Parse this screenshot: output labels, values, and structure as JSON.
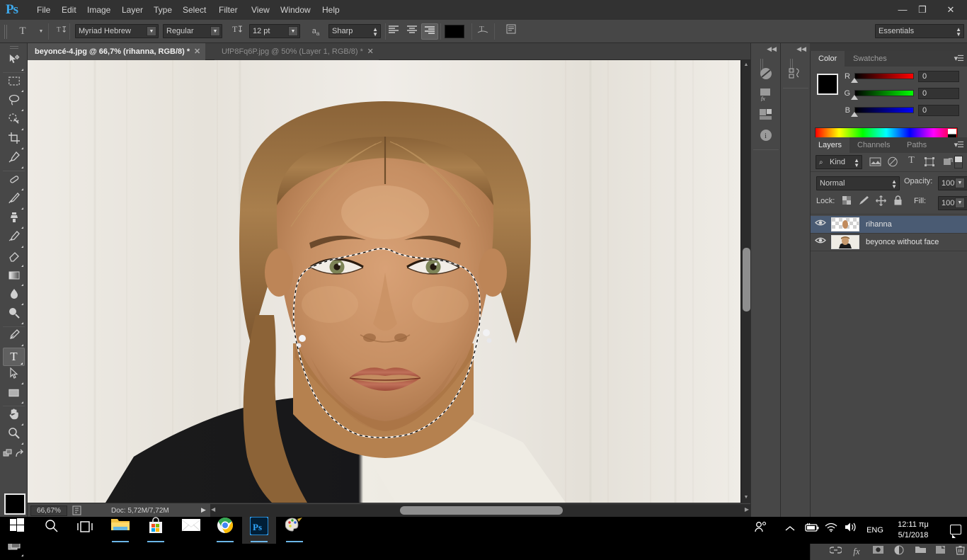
{
  "app": {
    "name": "Adobe Photoshop",
    "logo_text": "Ps",
    "workspace": "Essentials"
  },
  "titlebar": {
    "menus": [
      "File",
      "Edit",
      "Image",
      "Layer",
      "Type",
      "Select",
      "Filter",
      "View",
      "Window",
      "Help"
    ],
    "minimize": "—",
    "maximize": "❐",
    "close": "✕"
  },
  "options_bar": {
    "tool_icon": "T",
    "tool_preset_arrow": "▼",
    "orientation_icon": "text-orientation",
    "font_family": "Myriad Hebrew",
    "font_style": "Regular",
    "size_icon": "font-size",
    "font_size": "12 pt",
    "antialias_icon": "aa",
    "antialias": "Sharp",
    "align": [
      "align-left",
      "align-center",
      "align-right"
    ],
    "align_active": "align-right",
    "text_color": "#000000",
    "warp_icon": "warp-text",
    "panels_icon": "character-paragraph-panels"
  },
  "tabs": [
    {
      "label": "beyoncé-4.jpg @ 66,7% (rihanna, RGB/8) *",
      "active": true,
      "close": "✕"
    },
    {
      "label": "UfP8Fq6P.jpg @ 50% (Layer 1, RGB/8) *",
      "active": false,
      "close": "✕"
    }
  ],
  "toolbar": {
    "tools": [
      {
        "name": "move-tool",
        "glyph": "✥",
        "active": false
      },
      {
        "name": "rectangular-marquee-tool",
        "glyph": "▭",
        "active": false
      },
      {
        "name": "lasso-tool",
        "glyph": "◯",
        "active": false
      },
      {
        "name": "quick-selection-tool",
        "glyph": "✧",
        "active": false
      },
      {
        "name": "crop-tool",
        "glyph": "⌗",
        "active": false
      },
      {
        "name": "eyedropper-tool",
        "glyph": "⌁",
        "active": false
      },
      {
        "name": "spot-healing-brush-tool",
        "glyph": "✒",
        "active": false
      },
      {
        "name": "brush-tool",
        "glyph": "🖌",
        "active": false
      },
      {
        "name": "clone-stamp-tool",
        "glyph": "⎙",
        "active": false
      },
      {
        "name": "history-brush-tool",
        "glyph": "✎",
        "active": false
      },
      {
        "name": "eraser-tool",
        "glyph": "◺",
        "active": false
      },
      {
        "name": "gradient-tool",
        "glyph": "▤",
        "active": false
      },
      {
        "name": "blur-tool",
        "glyph": "💧",
        "active": false
      },
      {
        "name": "dodge-tool",
        "glyph": "🔍",
        "active": false
      },
      {
        "name": "pen-tool",
        "glyph": "✐",
        "active": false
      },
      {
        "name": "horizontal-type-tool",
        "glyph": "T",
        "active": true
      },
      {
        "name": "path-selection-tool",
        "glyph": "➤",
        "active": false
      },
      {
        "name": "rectangle-tool",
        "glyph": "▢",
        "active": false
      },
      {
        "name": "hand-tool",
        "glyph": "✋",
        "active": false
      },
      {
        "name": "zoom-tool",
        "glyph": "🔎",
        "active": false
      }
    ],
    "foreground_color": "#000000",
    "background_color": "#ffffff",
    "quick_mask_icon": "edit-in-quick-mask-mode",
    "screen_mode_icon": "change-screen-mode"
  },
  "canvas": {
    "selection": "marching-ants face selection",
    "scroll_vertical": "vertical-scrollbar",
    "scroll_horizontal": "horizontal-scrollbar"
  },
  "status_bar": {
    "zoom": "66,67%",
    "doc_info": "Doc: 5,72M/7,72M",
    "play_arrow": "▶",
    "left_arrow": "◀"
  },
  "icon_dock": [
    {
      "name": "history-panel-icon",
      "glyph": "⟲"
    },
    {
      "name": "actions-panel-icon",
      "glyph": "▤"
    },
    {
      "name": "adjustments-panel-icon",
      "glyph": "◨"
    },
    {
      "name": "info-panel-icon",
      "glyph": "i"
    },
    {
      "name": "character-styles-panel-icon",
      "glyph": "¶"
    }
  ],
  "color_panel": {
    "tabs": [
      "Color",
      "Swatches"
    ],
    "active_tab": "Color",
    "menu_icon": "panel-menu",
    "channels": [
      {
        "label": "R",
        "value": "0",
        "color": "#ff0000"
      },
      {
        "label": "G",
        "value": "0",
        "color": "#00ff00"
      },
      {
        "label": "B",
        "value": "0",
        "color": "#0000ff"
      }
    ],
    "foreground": "#000000",
    "background": "#ffffff"
  },
  "layers_panel": {
    "tabs": [
      "Layers",
      "Channels",
      "Paths"
    ],
    "active_tab": "Layers",
    "menu_icon": "panel-menu",
    "filter_label": "Kind",
    "filter_search_icon": "search-icon",
    "filter_icons": [
      "filter-pixel-icon",
      "filter-adjustment-icon",
      "filter-type-icon",
      "filter-shape-icon",
      "filter-smart-object-icon"
    ],
    "blend_mode": "Normal",
    "opacity_label": "Opacity:",
    "opacity_value": "100%",
    "lock_label": "Lock:",
    "lock_icons": [
      "lock-transparent-pixels",
      "lock-image-pixels",
      "lock-position",
      "lock-all"
    ],
    "fill_label": "Fill:",
    "fill_value": "100%",
    "layers": [
      {
        "name": "rihanna",
        "visible": true,
        "selected": true,
        "eye": "👁"
      },
      {
        "name": "beyonce without face",
        "visible": true,
        "selected": false,
        "eye": "👁"
      }
    ],
    "bottom_buttons": [
      {
        "name": "link-layers-button",
        "glyph": "⛓"
      },
      {
        "name": "layer-style-button",
        "glyph": "fx"
      },
      {
        "name": "layer-mask-button",
        "glyph": "◉"
      },
      {
        "name": "new-fill-adjustment-button",
        "glyph": "◐"
      },
      {
        "name": "new-group-button",
        "glyph": "🗀"
      },
      {
        "name": "new-layer-button",
        "glyph": "❐"
      },
      {
        "name": "delete-layer-button",
        "glyph": "🗑"
      }
    ]
  },
  "taskbar": {
    "items": [
      {
        "name": "start-button",
        "glyph": "windows-logo",
        "running": false,
        "active": false
      },
      {
        "name": "search-button",
        "glyph": "search-icon",
        "running": false,
        "active": false
      },
      {
        "name": "task-view-button",
        "glyph": "task-view-icon",
        "running": false,
        "active": false
      },
      {
        "name": "file-explorer-button",
        "glyph": "folder-icon",
        "running": true,
        "active": false
      },
      {
        "name": "microsoft-store-button",
        "glyph": "store-icon",
        "running": false,
        "active": false
      },
      {
        "name": "mail-button",
        "glyph": "mail-icon",
        "running": false,
        "active": false
      },
      {
        "name": "google-chrome-button",
        "glyph": "chrome-icon",
        "running": true,
        "active": false
      },
      {
        "name": "photoshop-button",
        "glyph": "photoshop-icon",
        "running": true,
        "active": true
      },
      {
        "name": "paint-button",
        "glyph": "paint-icon",
        "running": true,
        "active": false
      }
    ],
    "tray": [
      {
        "name": "people-icon",
        "glyph": "people"
      },
      {
        "name": "show-hidden-icons-icon",
        "glyph": "⌃"
      },
      {
        "name": "battery-icon",
        "glyph": "battery"
      },
      {
        "name": "network-icon",
        "glyph": "wifi"
      },
      {
        "name": "volume-icon",
        "glyph": "speaker"
      }
    ],
    "language": "ENG",
    "clock_time": "12:11 πμ",
    "clock_date": "5/1/2018",
    "action_center": "notification-icon"
  }
}
